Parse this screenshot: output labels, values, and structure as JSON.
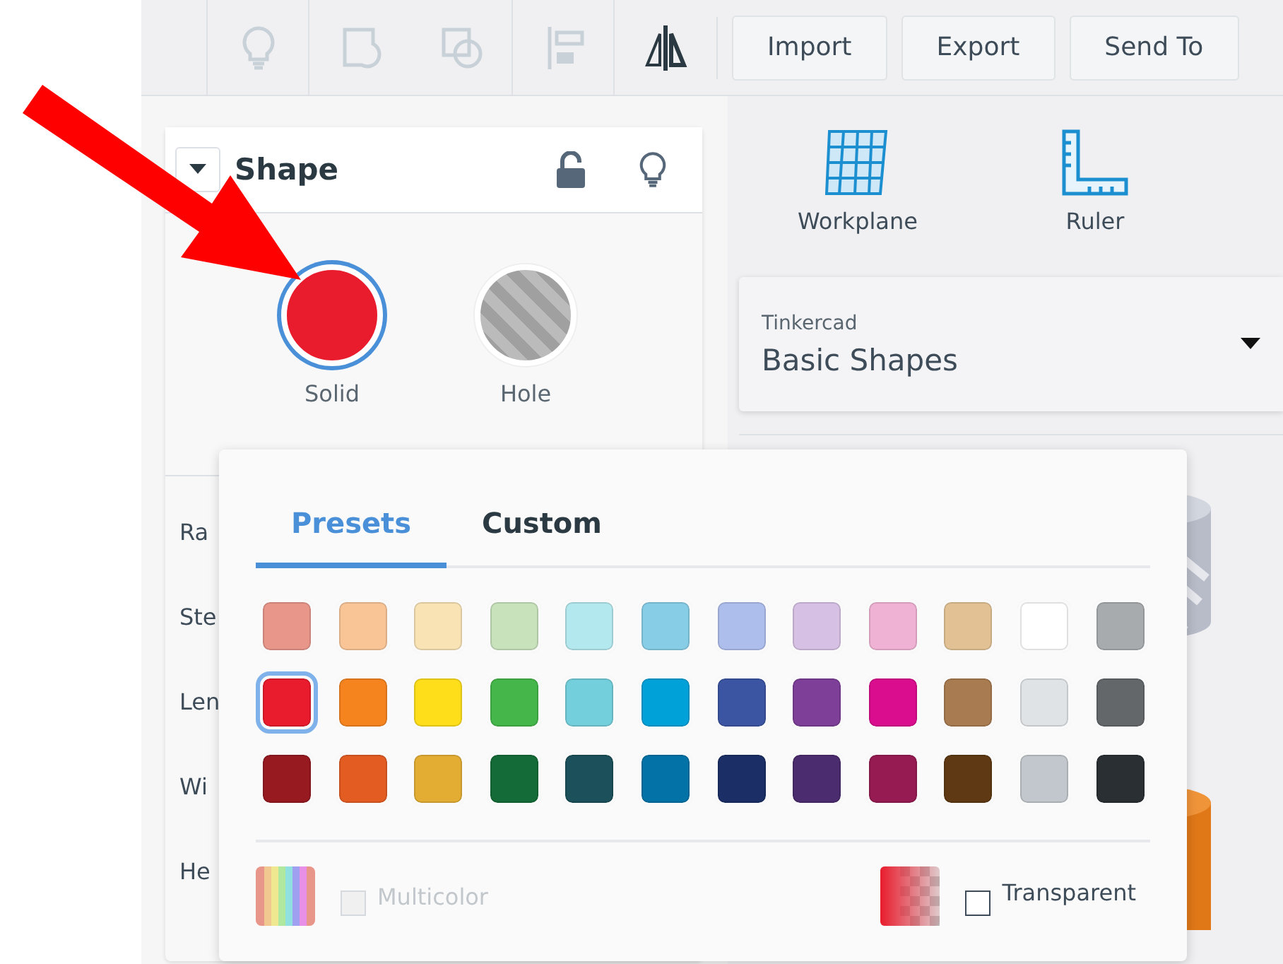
{
  "toolbar": {
    "tools": [
      {
        "kind": "bulb",
        "disabled": true
      },
      {
        "kind": "group",
        "disabled": true
      },
      {
        "kind": "ungroup",
        "disabled": true
      },
      {
        "kind": "align",
        "disabled": true
      },
      {
        "kind": "mirror",
        "disabled": false
      }
    ],
    "buttons": [
      "Import",
      "Export",
      "Send To"
    ]
  },
  "shape_panel": {
    "title": "Shape",
    "expanded": true,
    "locked": false,
    "modes": [
      {
        "label": "Solid",
        "kind": "solid",
        "selected": true
      },
      {
        "label": "Hole",
        "kind": "hole",
        "selected": false
      }
    ],
    "properties": [
      {
        "label": "Ra"
      },
      {
        "label": "Ste"
      },
      {
        "label": "Len"
      },
      {
        "label": "Wi"
      },
      {
        "label": "He"
      }
    ]
  },
  "right_panel": {
    "tools": [
      {
        "label": "Workplane",
        "kind": "workplane"
      },
      {
        "label": "Ruler",
        "kind": "ruler"
      }
    ],
    "library": {
      "source": "Tinkercad",
      "value": "Basic Shapes"
    }
  },
  "color_popup": {
    "tabs": [
      {
        "label": "Presets",
        "selected": true
      },
      {
        "label": "Custom",
        "selected": false
      }
    ],
    "swatches": [
      {
        "color": "#e8968a",
        "selected": false
      },
      {
        "color": "#f9c597",
        "selected": false
      },
      {
        "color": "#f9e3b4",
        "selected": false
      },
      {
        "color": "#c8e2bb",
        "selected": false
      },
      {
        "color": "#b3e8ef",
        "selected": false
      },
      {
        "color": "#87cde6",
        "selected": false
      },
      {
        "color": "#adbeed",
        "selected": false
      },
      {
        "color": "#d6c0e4",
        "selected": false
      },
      {
        "color": "#f0b2d4",
        "selected": false
      },
      {
        "color": "#e2c295",
        "selected": false
      },
      {
        "color": "#ffffff",
        "selected": false
      },
      {
        "color": "#a7abae",
        "selected": false
      },
      {
        "color": "#e91c2d",
        "selected": true
      },
      {
        "color": "#f5841f",
        "selected": false
      },
      {
        "color": "#fedd1a",
        "selected": false
      },
      {
        "color": "#45b649",
        "selected": false
      },
      {
        "color": "#74cfdc",
        "selected": false
      },
      {
        "color": "#00a1d8",
        "selected": false
      },
      {
        "color": "#3b55a2",
        "selected": false
      },
      {
        "color": "#7d3f98",
        "selected": false
      },
      {
        "color": "#db0d8f",
        "selected": false
      },
      {
        "color": "#a87b50",
        "selected": false
      },
      {
        "color": "#dfe3e5",
        "selected": false
      },
      {
        "color": "#636769",
        "selected": false
      },
      {
        "color": "#961a20",
        "selected": false
      },
      {
        "color": "#e35d23",
        "selected": false
      },
      {
        "color": "#e3ad34",
        "selected": false
      },
      {
        "color": "#146b37",
        "selected": false
      },
      {
        "color": "#1c505a",
        "selected": false
      },
      {
        "color": "#0272a7",
        "selected": false
      },
      {
        "color": "#1b2f66",
        "selected": false
      },
      {
        "color": "#4b2c6f",
        "selected": false
      },
      {
        "color": "#961b52",
        "selected": false
      },
      {
        "color": "#5f3913",
        "selected": false
      },
      {
        "color": "#c1c7cc",
        "selected": false
      },
      {
        "color": "#2a2f33",
        "selected": false
      }
    ],
    "multicolor": {
      "label": "Multicolor",
      "checked": false,
      "disabled": true
    },
    "transparent": {
      "label": "Transparent",
      "checked": false,
      "disabled": false
    }
  }
}
